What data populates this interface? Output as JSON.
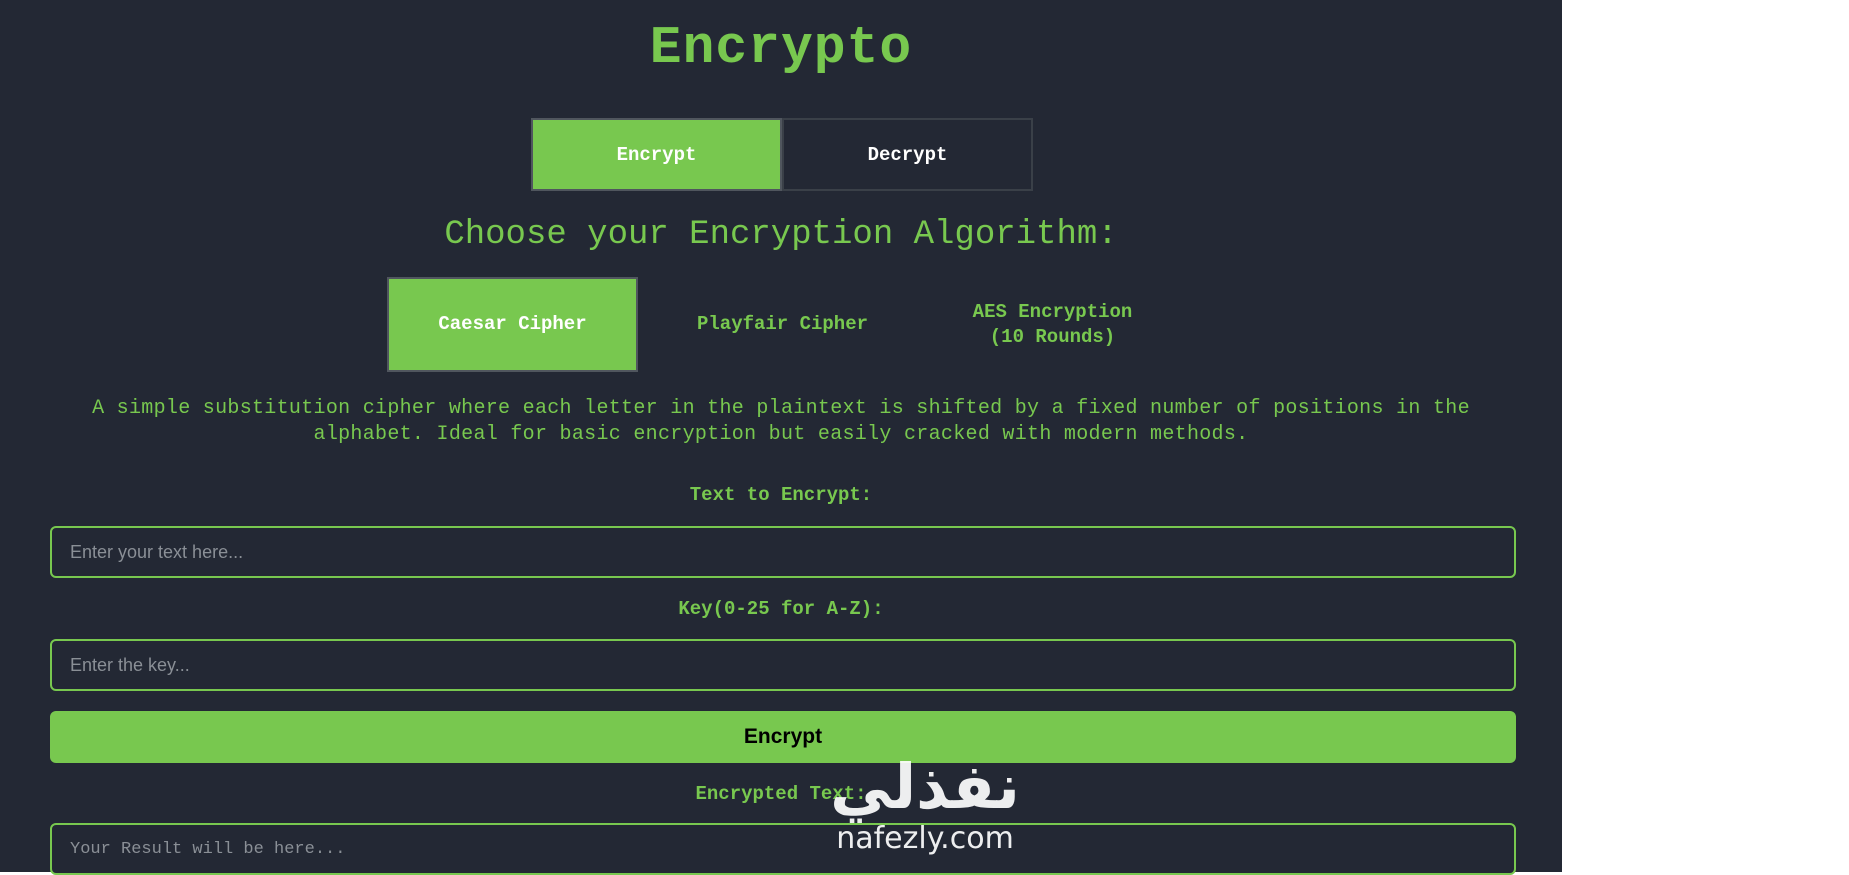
{
  "app": {
    "title": "Encrypto"
  },
  "mode_tabs": [
    {
      "label": "Encrypt",
      "active": true
    },
    {
      "label": "Decrypt",
      "active": false
    }
  ],
  "algorithm_heading": "Choose your Encryption Algorithm:",
  "algorithms": [
    {
      "label": "Caesar Cipher",
      "active": true
    },
    {
      "label": "Playfair Cipher",
      "active": false
    },
    {
      "label": "AES Encryption\n(10 Rounds)",
      "active": false
    }
  ],
  "description": "A simple substitution cipher where each letter in the plaintext is shifted by a fixed number of positions in the alphabet. Ideal for basic encryption but easily cracked with modern methods.",
  "form": {
    "text_label": "Text to Encrypt:",
    "text_placeholder": "Enter your text here...",
    "key_label": "Key(0-25 for A-Z):",
    "key_placeholder": "Enter the key...",
    "submit_label": "Encrypt",
    "result_label": "Encrypted Text:",
    "result_placeholder": "Your Result will be here..."
  },
  "watermark": {
    "arabic": "نفذلي",
    "latin": "nafezly.com"
  },
  "colors": {
    "accent": "#78c84f",
    "background": "#232834",
    "page": "#ffffff"
  }
}
